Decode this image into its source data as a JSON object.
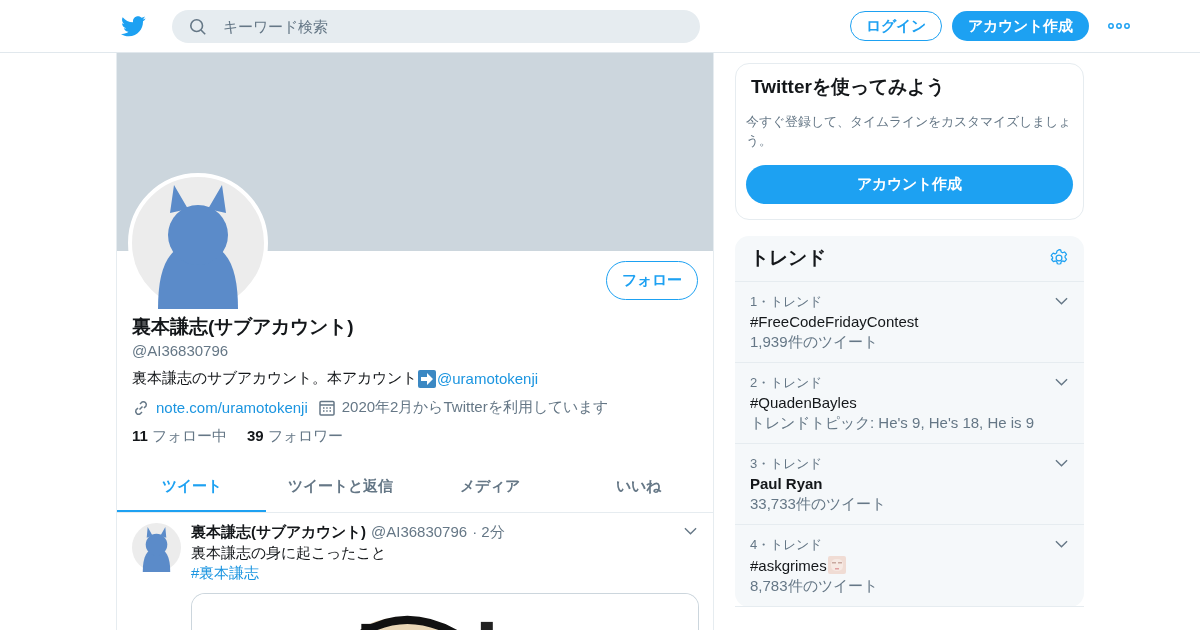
{
  "header": {
    "search": {
      "placeholder": "キーワード検索"
    },
    "login_button": "ログイン",
    "signup_button": "アカウント作成"
  },
  "profile": {
    "name": "裏本謙志(サブアカウント)",
    "handle": "@AI36830796",
    "bio": "裏本謙志のサブアカウント。本アカウント",
    "bio_link": "@uramotokenji",
    "website": "note.com/uramotokenji",
    "joined": "2020年2月からTwitterを利用しています",
    "following_count": "11",
    "following_label": "フォロー中",
    "followers_count": "39",
    "followers_label": "フォロワー",
    "follow_button": "フォロー"
  },
  "tabs": [
    {
      "label": "ツイート",
      "selected": true
    },
    {
      "label": "ツイートと返信",
      "selected": false
    },
    {
      "label": "メディア",
      "selected": false
    },
    {
      "label": "いいね",
      "selected": false
    }
  ],
  "tweets": [
    {
      "name": "裏本謙志(サブアカウント)",
      "handle": "@AI36830796",
      "time": "· 2分",
      "text": "裏本謙志の身に起こったこと",
      "hashtag": "#裏本謙志"
    }
  ],
  "signup_card": {
    "title": "Twitterを使ってみよう",
    "description": "今すぐ登録して、タイムラインをカスタマイズしましょう。",
    "button": "アカウント作成"
  },
  "trends": {
    "title": "トレンド",
    "items": [
      {
        "rank": "1・トレンド",
        "name": "#FreeCodeFridayContest",
        "emphasized": false,
        "emoji": false,
        "meta": "1,939件のツイート"
      },
      {
        "rank": "2・トレンド",
        "name": "#QuadenBayles",
        "emphasized": false,
        "emoji": false,
        "meta": "トレンドトピック: He's 9, He's 18, He is 9"
      },
      {
        "rank": "3・トレンド",
        "name": "Paul Ryan",
        "emphasized": true,
        "emoji": false,
        "meta": "33,733件のツイート"
      },
      {
        "rank": "4・トレンド",
        "name": "#askgrimes",
        "emphasized": false,
        "emoji": true,
        "meta": "8,783件のツイート"
      }
    ]
  }
}
